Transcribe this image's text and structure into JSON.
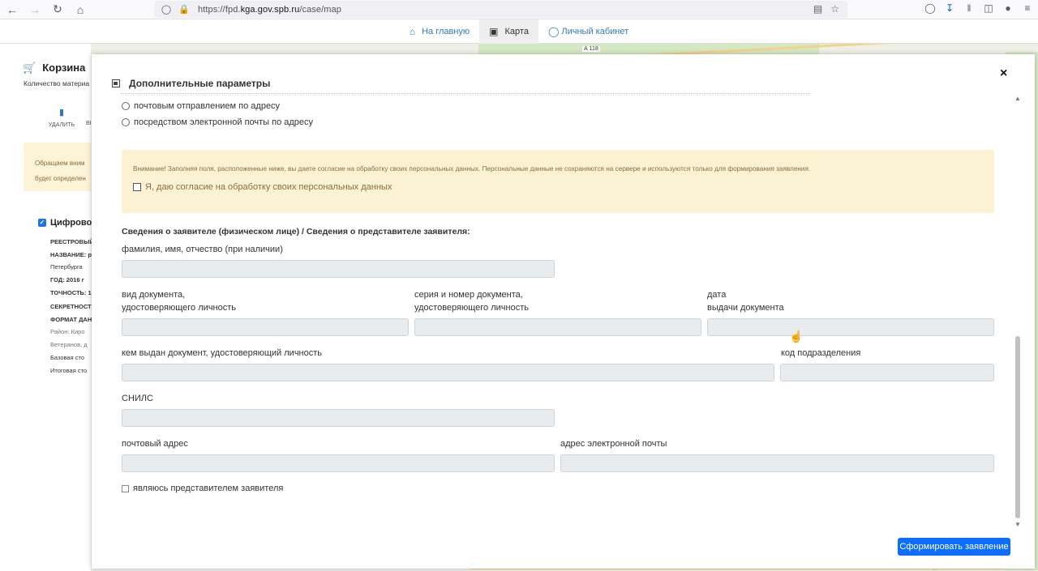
{
  "browser": {
    "url_prefix": "https://fpd.",
    "url_domain": "kga.gov.spb.ru",
    "url_path": "/case/map"
  },
  "topnav": {
    "home": "На главную",
    "map": "Карта",
    "cabinet": "Личный кабинет"
  },
  "map_label": "А 118",
  "sidebar": {
    "title": "Корзина",
    "count_text": "Количество материа",
    "delete": "УДАЛИТЬ",
    "delete_next": "ВЫ",
    "alert_line1": "Обращаем вним",
    "alert_line2": "будет определен",
    "item_title": "Цифровой п",
    "props": [
      "РЕЕСТРОВЫЙ",
      "НАЗВАНИЕ:  р",
      "Петербурга",
      "ГОД:  2016   г",
      "ТОЧНОСТЬ:  1",
      "СЕКРЕТНОСТЬ",
      "ФОРМАТ ДАН",
      "Район: Киро",
      "Ветеранов, д",
      "Базовая сто",
      "Итоговая сто"
    ]
  },
  "modal": {
    "title": "Дополнительные параметры",
    "close": "×",
    "radio_options": [
      "почтовым отправлением по адресу",
      "посредством электронной почты по адресу"
    ],
    "alert_text": "Внимание! Заполняя поля, расположенные ниже, вы даете согласие на обработку своих персональных данных. Персональные данные не сохраняются на сервере и используются только для формирования заявления.",
    "consent_label": "Я, даю согласие на обработку своих персональных данных",
    "section_title": "Сведения о заявителе (физическом лице) / Сведения о представителе заявителя:",
    "fields": {
      "fio": "фамилия, имя, отчество (при наличии)",
      "doc_type_1": "вид документа,",
      "doc_type_2": "удостоверяющего личность",
      "doc_num_1": "серия и номер документа,",
      "doc_num_2": "удостоверяющего личность",
      "doc_date_1": "дата",
      "doc_date_2": "выдачи документа",
      "issued_by": "кем выдан документ, удостоверяющий личность",
      "dept_code": "код подразделения",
      "snils": "СНИЛС",
      "postal": "почтовый адрес",
      "email": "адрес электронной почты"
    },
    "representative": "являюсь представителем заявителя",
    "submit": "Сформировать заявление"
  },
  "colors": {
    "primary": "#0d6efd",
    "alert_bg": "#fcf3d4",
    "alert_text": "#8a6d3b",
    "input_bg": "#e9ecef",
    "link": "#337ab7"
  }
}
